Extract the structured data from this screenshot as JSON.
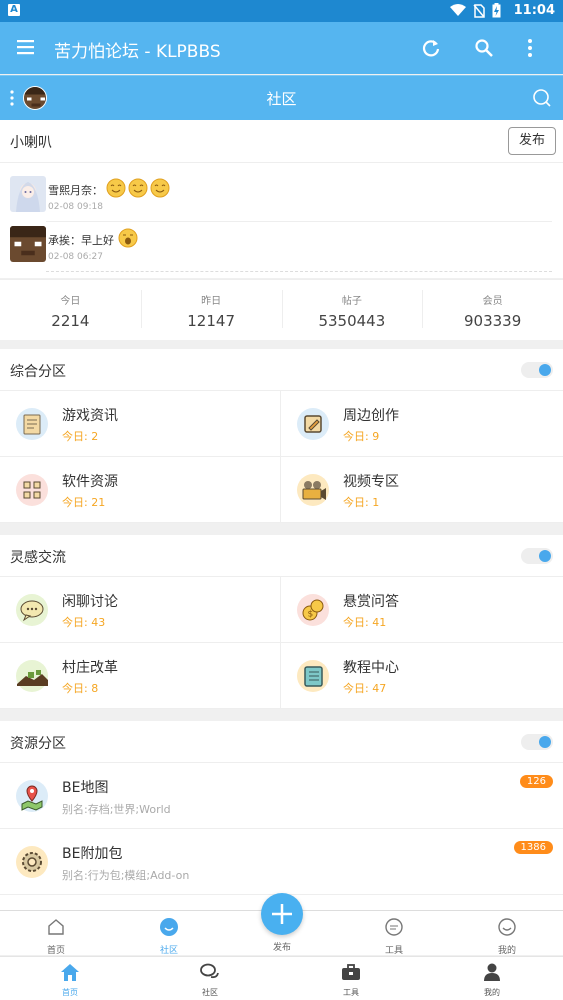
{
  "status_bar": {
    "time": "11:04"
  },
  "app_bar": {
    "title": "苦力怕论坛 - KLPBBS"
  },
  "community_header": {
    "title": "社区"
  },
  "horn": {
    "title": "小喇叭",
    "publish_label": "发布",
    "posts": [
      {
        "user": "雪熙月奈：",
        "time": "02-08 09:18"
      },
      {
        "user": "承挨：早上好",
        "time": "02-08 06:27"
      }
    ]
  },
  "stats": [
    {
      "label": "今日",
      "value": "2214"
    },
    {
      "label": "昨日",
      "value": "12147"
    },
    {
      "label": "帖子",
      "value": "5350443"
    },
    {
      "label": "会员",
      "value": "903339"
    }
  ],
  "sections": {
    "general": {
      "title": "综合分区",
      "forums": [
        {
          "name": "游戏资讯",
          "today": "今日: 2",
          "icon": "news-icon"
        },
        {
          "name": "周边创作",
          "today": "今日: 9",
          "icon": "pencil-icon"
        },
        {
          "name": "软件资源",
          "today": "今日: 21",
          "icon": "software-icon"
        },
        {
          "name": "视频专区",
          "today": "今日: 1",
          "icon": "video-camera-icon"
        }
      ]
    },
    "inspiration": {
      "title": "灵感交流",
      "forums": [
        {
          "name": "闲聊讨论",
          "today": "今日: 43",
          "icon": "chat-bubble-icon"
        },
        {
          "name": "悬赏问答",
          "today": "今日: 41",
          "icon": "coins-icon"
        },
        {
          "name": "村庄改革",
          "today": "今日: 8",
          "icon": "village-icon"
        },
        {
          "name": "教程中心",
          "today": "今日: 47",
          "icon": "tutorial-book-icon"
        }
      ]
    },
    "resources": {
      "title": "资源分区",
      "forums": [
        {
          "name": "BE地图",
          "alias": "别名:存档;世界;World",
          "badge": "126",
          "icon": "map-pin-icon"
        },
        {
          "name": "BE附加包",
          "alias": "别名:行为包;模组;Add-on",
          "badge": "1386",
          "icon": "gear-icon"
        }
      ]
    }
  },
  "nav_top": {
    "home": "首页",
    "community": "社区",
    "publish": "发布",
    "tools": "工具",
    "mine": "我的"
  },
  "nav_bottom": {
    "home": "首页",
    "community": "社区",
    "tools": "工具",
    "mine": "我的"
  },
  "colors": {
    "primary": "#55b5f0",
    "accent": "#49a8ec",
    "orange": "#f5a623",
    "badge": "#ff8c1a"
  }
}
